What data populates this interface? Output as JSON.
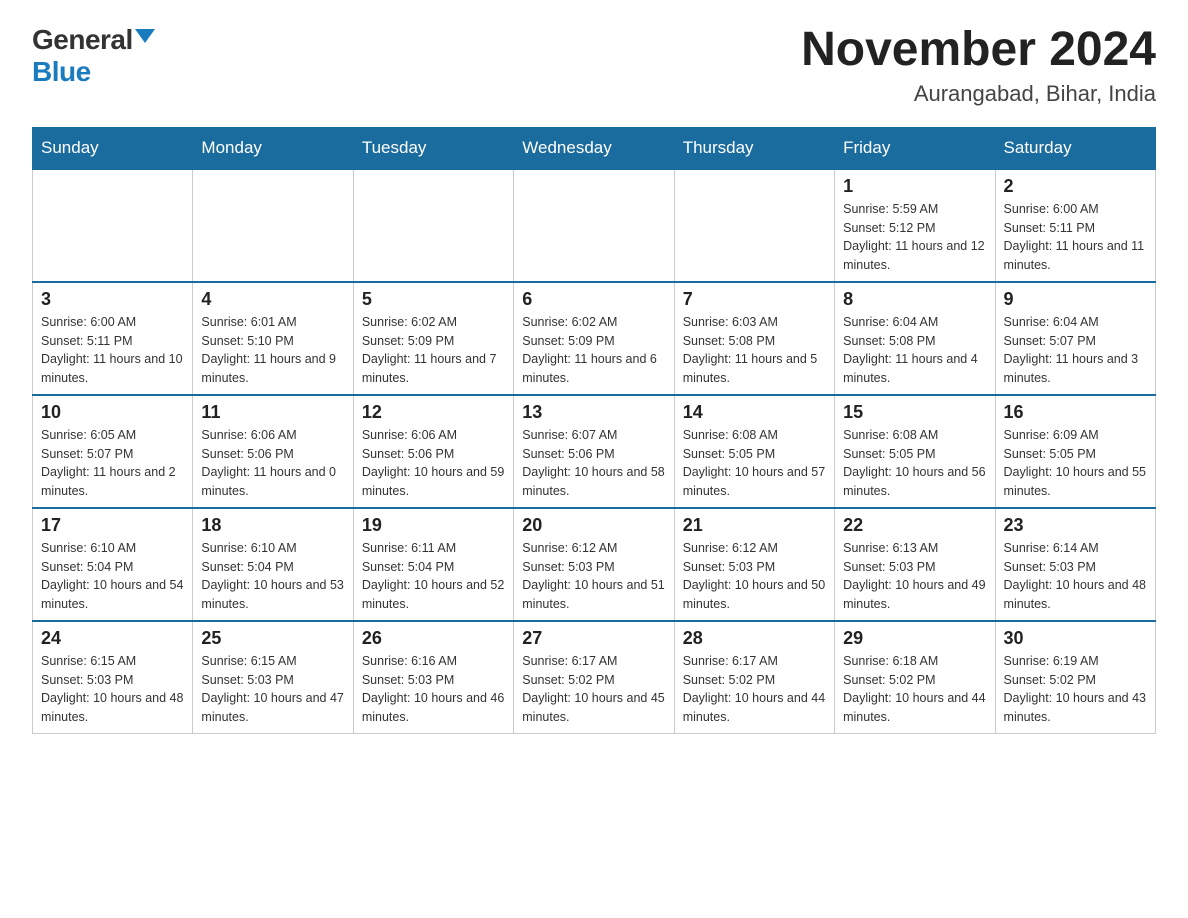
{
  "logo": {
    "general": "General",
    "blue": "Blue"
  },
  "header": {
    "month": "November 2024",
    "location": "Aurangabad, Bihar, India"
  },
  "weekdays": [
    "Sunday",
    "Monday",
    "Tuesday",
    "Wednesday",
    "Thursday",
    "Friday",
    "Saturday"
  ],
  "weeks": [
    [
      {
        "day": "",
        "sunrise": "",
        "sunset": "",
        "daylight": ""
      },
      {
        "day": "",
        "sunrise": "",
        "sunset": "",
        "daylight": ""
      },
      {
        "day": "",
        "sunrise": "",
        "sunset": "",
        "daylight": ""
      },
      {
        "day": "",
        "sunrise": "",
        "sunset": "",
        "daylight": ""
      },
      {
        "day": "",
        "sunrise": "",
        "sunset": "",
        "daylight": ""
      },
      {
        "day": "1",
        "sunrise": "Sunrise: 5:59 AM",
        "sunset": "Sunset: 5:12 PM",
        "daylight": "Daylight: 11 hours and 12 minutes."
      },
      {
        "day": "2",
        "sunrise": "Sunrise: 6:00 AM",
        "sunset": "Sunset: 5:11 PM",
        "daylight": "Daylight: 11 hours and 11 minutes."
      }
    ],
    [
      {
        "day": "3",
        "sunrise": "Sunrise: 6:00 AM",
        "sunset": "Sunset: 5:11 PM",
        "daylight": "Daylight: 11 hours and 10 minutes."
      },
      {
        "day": "4",
        "sunrise": "Sunrise: 6:01 AM",
        "sunset": "Sunset: 5:10 PM",
        "daylight": "Daylight: 11 hours and 9 minutes."
      },
      {
        "day": "5",
        "sunrise": "Sunrise: 6:02 AM",
        "sunset": "Sunset: 5:09 PM",
        "daylight": "Daylight: 11 hours and 7 minutes."
      },
      {
        "day": "6",
        "sunrise": "Sunrise: 6:02 AM",
        "sunset": "Sunset: 5:09 PM",
        "daylight": "Daylight: 11 hours and 6 minutes."
      },
      {
        "day": "7",
        "sunrise": "Sunrise: 6:03 AM",
        "sunset": "Sunset: 5:08 PM",
        "daylight": "Daylight: 11 hours and 5 minutes."
      },
      {
        "day": "8",
        "sunrise": "Sunrise: 6:04 AM",
        "sunset": "Sunset: 5:08 PM",
        "daylight": "Daylight: 11 hours and 4 minutes."
      },
      {
        "day": "9",
        "sunrise": "Sunrise: 6:04 AM",
        "sunset": "Sunset: 5:07 PM",
        "daylight": "Daylight: 11 hours and 3 minutes."
      }
    ],
    [
      {
        "day": "10",
        "sunrise": "Sunrise: 6:05 AM",
        "sunset": "Sunset: 5:07 PM",
        "daylight": "Daylight: 11 hours and 2 minutes."
      },
      {
        "day": "11",
        "sunrise": "Sunrise: 6:06 AM",
        "sunset": "Sunset: 5:06 PM",
        "daylight": "Daylight: 11 hours and 0 minutes."
      },
      {
        "day": "12",
        "sunrise": "Sunrise: 6:06 AM",
        "sunset": "Sunset: 5:06 PM",
        "daylight": "Daylight: 10 hours and 59 minutes."
      },
      {
        "day": "13",
        "sunrise": "Sunrise: 6:07 AM",
        "sunset": "Sunset: 5:06 PM",
        "daylight": "Daylight: 10 hours and 58 minutes."
      },
      {
        "day": "14",
        "sunrise": "Sunrise: 6:08 AM",
        "sunset": "Sunset: 5:05 PM",
        "daylight": "Daylight: 10 hours and 57 minutes."
      },
      {
        "day": "15",
        "sunrise": "Sunrise: 6:08 AM",
        "sunset": "Sunset: 5:05 PM",
        "daylight": "Daylight: 10 hours and 56 minutes."
      },
      {
        "day": "16",
        "sunrise": "Sunrise: 6:09 AM",
        "sunset": "Sunset: 5:05 PM",
        "daylight": "Daylight: 10 hours and 55 minutes."
      }
    ],
    [
      {
        "day": "17",
        "sunrise": "Sunrise: 6:10 AM",
        "sunset": "Sunset: 5:04 PM",
        "daylight": "Daylight: 10 hours and 54 minutes."
      },
      {
        "day": "18",
        "sunrise": "Sunrise: 6:10 AM",
        "sunset": "Sunset: 5:04 PM",
        "daylight": "Daylight: 10 hours and 53 minutes."
      },
      {
        "day": "19",
        "sunrise": "Sunrise: 6:11 AM",
        "sunset": "Sunset: 5:04 PM",
        "daylight": "Daylight: 10 hours and 52 minutes."
      },
      {
        "day": "20",
        "sunrise": "Sunrise: 6:12 AM",
        "sunset": "Sunset: 5:03 PM",
        "daylight": "Daylight: 10 hours and 51 minutes."
      },
      {
        "day": "21",
        "sunrise": "Sunrise: 6:12 AM",
        "sunset": "Sunset: 5:03 PM",
        "daylight": "Daylight: 10 hours and 50 minutes."
      },
      {
        "day": "22",
        "sunrise": "Sunrise: 6:13 AM",
        "sunset": "Sunset: 5:03 PM",
        "daylight": "Daylight: 10 hours and 49 minutes."
      },
      {
        "day": "23",
        "sunrise": "Sunrise: 6:14 AM",
        "sunset": "Sunset: 5:03 PM",
        "daylight": "Daylight: 10 hours and 48 minutes."
      }
    ],
    [
      {
        "day": "24",
        "sunrise": "Sunrise: 6:15 AM",
        "sunset": "Sunset: 5:03 PM",
        "daylight": "Daylight: 10 hours and 48 minutes."
      },
      {
        "day": "25",
        "sunrise": "Sunrise: 6:15 AM",
        "sunset": "Sunset: 5:03 PM",
        "daylight": "Daylight: 10 hours and 47 minutes."
      },
      {
        "day": "26",
        "sunrise": "Sunrise: 6:16 AM",
        "sunset": "Sunset: 5:03 PM",
        "daylight": "Daylight: 10 hours and 46 minutes."
      },
      {
        "day": "27",
        "sunrise": "Sunrise: 6:17 AM",
        "sunset": "Sunset: 5:02 PM",
        "daylight": "Daylight: 10 hours and 45 minutes."
      },
      {
        "day": "28",
        "sunrise": "Sunrise: 6:17 AM",
        "sunset": "Sunset: 5:02 PM",
        "daylight": "Daylight: 10 hours and 44 minutes."
      },
      {
        "day": "29",
        "sunrise": "Sunrise: 6:18 AM",
        "sunset": "Sunset: 5:02 PM",
        "daylight": "Daylight: 10 hours and 44 minutes."
      },
      {
        "day": "30",
        "sunrise": "Sunrise: 6:19 AM",
        "sunset": "Sunset: 5:02 PM",
        "daylight": "Daylight: 10 hours and 43 minutes."
      }
    ]
  ]
}
